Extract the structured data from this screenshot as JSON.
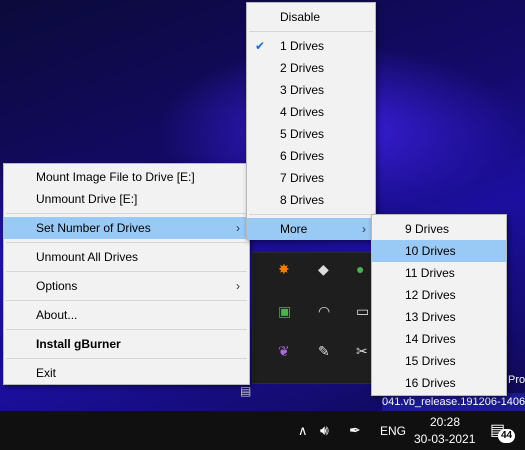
{
  "main_menu": {
    "items": [
      {
        "label": "Mount Image File to Drive [E:]"
      },
      {
        "label": "Unmount Drive [E:]"
      },
      {
        "label": "Set Number of Drives"
      },
      {
        "label": "Unmount All Drives"
      },
      {
        "label": "Options"
      },
      {
        "label": "About..."
      },
      {
        "label": "Install gBurner"
      },
      {
        "label": "Exit"
      }
    ]
  },
  "drives_menu": {
    "disable_label": "Disable",
    "items": [
      "1 Drives",
      "2 Drives",
      "3 Drives",
      "4 Drives",
      "5 Drives",
      "6 Drives",
      "7 Drives",
      "8 Drives"
    ],
    "checked": "1 Drives",
    "more_label": "More"
  },
  "more_menu": {
    "items": [
      "9 Drives",
      "10 Drives",
      "11 Drives",
      "12 Drives",
      "13 Drives",
      "14 Drives",
      "15 Drives",
      "16 Drives"
    ],
    "highlighted": "10 Drives"
  },
  "taskbar": {
    "banner_text": "041.vb_release.191206-1406",
    "banner_pro": "Pro",
    "language": "ENG",
    "time": "20:28",
    "date": "30-03-2021",
    "notification_count": "44"
  },
  "colors": {
    "highlight": "#99c9f5",
    "menu_bg": "#f2f2f2",
    "taskbar_bg": "#101010"
  }
}
